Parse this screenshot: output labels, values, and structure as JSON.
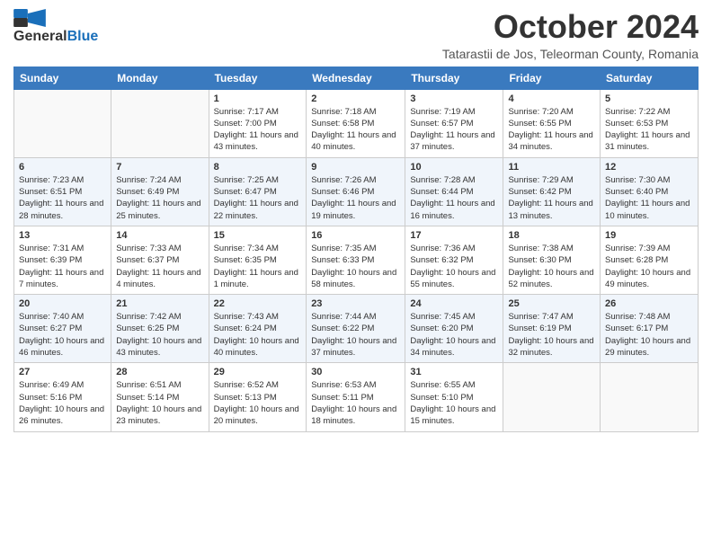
{
  "header": {
    "logo_line1": "General",
    "logo_line2": "Blue",
    "month": "October 2024",
    "location": "Tatarastii de Jos, Teleorman County, Romania"
  },
  "weekdays": [
    "Sunday",
    "Monday",
    "Tuesday",
    "Wednesday",
    "Thursday",
    "Friday",
    "Saturday"
  ],
  "weeks": [
    [
      {
        "day": "",
        "info": ""
      },
      {
        "day": "",
        "info": ""
      },
      {
        "day": "1",
        "info": "Sunrise: 7:17 AM\nSunset: 7:00 PM\nDaylight: 11 hours and 43 minutes."
      },
      {
        "day": "2",
        "info": "Sunrise: 7:18 AM\nSunset: 6:58 PM\nDaylight: 11 hours and 40 minutes."
      },
      {
        "day": "3",
        "info": "Sunrise: 7:19 AM\nSunset: 6:57 PM\nDaylight: 11 hours and 37 minutes."
      },
      {
        "day": "4",
        "info": "Sunrise: 7:20 AM\nSunset: 6:55 PM\nDaylight: 11 hours and 34 minutes."
      },
      {
        "day": "5",
        "info": "Sunrise: 7:22 AM\nSunset: 6:53 PM\nDaylight: 11 hours and 31 minutes."
      }
    ],
    [
      {
        "day": "6",
        "info": "Sunrise: 7:23 AM\nSunset: 6:51 PM\nDaylight: 11 hours and 28 minutes."
      },
      {
        "day": "7",
        "info": "Sunrise: 7:24 AM\nSunset: 6:49 PM\nDaylight: 11 hours and 25 minutes."
      },
      {
        "day": "8",
        "info": "Sunrise: 7:25 AM\nSunset: 6:47 PM\nDaylight: 11 hours and 22 minutes."
      },
      {
        "day": "9",
        "info": "Sunrise: 7:26 AM\nSunset: 6:46 PM\nDaylight: 11 hours and 19 minutes."
      },
      {
        "day": "10",
        "info": "Sunrise: 7:28 AM\nSunset: 6:44 PM\nDaylight: 11 hours and 16 minutes."
      },
      {
        "day": "11",
        "info": "Sunrise: 7:29 AM\nSunset: 6:42 PM\nDaylight: 11 hours and 13 minutes."
      },
      {
        "day": "12",
        "info": "Sunrise: 7:30 AM\nSunset: 6:40 PM\nDaylight: 11 hours and 10 minutes."
      }
    ],
    [
      {
        "day": "13",
        "info": "Sunrise: 7:31 AM\nSunset: 6:39 PM\nDaylight: 11 hours and 7 minutes."
      },
      {
        "day": "14",
        "info": "Sunrise: 7:33 AM\nSunset: 6:37 PM\nDaylight: 11 hours and 4 minutes."
      },
      {
        "day": "15",
        "info": "Sunrise: 7:34 AM\nSunset: 6:35 PM\nDaylight: 11 hours and 1 minute."
      },
      {
        "day": "16",
        "info": "Sunrise: 7:35 AM\nSunset: 6:33 PM\nDaylight: 10 hours and 58 minutes."
      },
      {
        "day": "17",
        "info": "Sunrise: 7:36 AM\nSunset: 6:32 PM\nDaylight: 10 hours and 55 minutes."
      },
      {
        "day": "18",
        "info": "Sunrise: 7:38 AM\nSunset: 6:30 PM\nDaylight: 10 hours and 52 minutes."
      },
      {
        "day": "19",
        "info": "Sunrise: 7:39 AM\nSunset: 6:28 PM\nDaylight: 10 hours and 49 minutes."
      }
    ],
    [
      {
        "day": "20",
        "info": "Sunrise: 7:40 AM\nSunset: 6:27 PM\nDaylight: 10 hours and 46 minutes."
      },
      {
        "day": "21",
        "info": "Sunrise: 7:42 AM\nSunset: 6:25 PM\nDaylight: 10 hours and 43 minutes."
      },
      {
        "day": "22",
        "info": "Sunrise: 7:43 AM\nSunset: 6:24 PM\nDaylight: 10 hours and 40 minutes."
      },
      {
        "day": "23",
        "info": "Sunrise: 7:44 AM\nSunset: 6:22 PM\nDaylight: 10 hours and 37 minutes."
      },
      {
        "day": "24",
        "info": "Sunrise: 7:45 AM\nSunset: 6:20 PM\nDaylight: 10 hours and 34 minutes."
      },
      {
        "day": "25",
        "info": "Sunrise: 7:47 AM\nSunset: 6:19 PM\nDaylight: 10 hours and 32 minutes."
      },
      {
        "day": "26",
        "info": "Sunrise: 7:48 AM\nSunset: 6:17 PM\nDaylight: 10 hours and 29 minutes."
      }
    ],
    [
      {
        "day": "27",
        "info": "Sunrise: 6:49 AM\nSunset: 5:16 PM\nDaylight: 10 hours and 26 minutes."
      },
      {
        "day": "28",
        "info": "Sunrise: 6:51 AM\nSunset: 5:14 PM\nDaylight: 10 hours and 23 minutes."
      },
      {
        "day": "29",
        "info": "Sunrise: 6:52 AM\nSunset: 5:13 PM\nDaylight: 10 hours and 20 minutes."
      },
      {
        "day": "30",
        "info": "Sunrise: 6:53 AM\nSunset: 5:11 PM\nDaylight: 10 hours and 18 minutes."
      },
      {
        "day": "31",
        "info": "Sunrise: 6:55 AM\nSunset: 5:10 PM\nDaylight: 10 hours and 15 minutes."
      },
      {
        "day": "",
        "info": ""
      },
      {
        "day": "",
        "info": ""
      }
    ]
  ]
}
